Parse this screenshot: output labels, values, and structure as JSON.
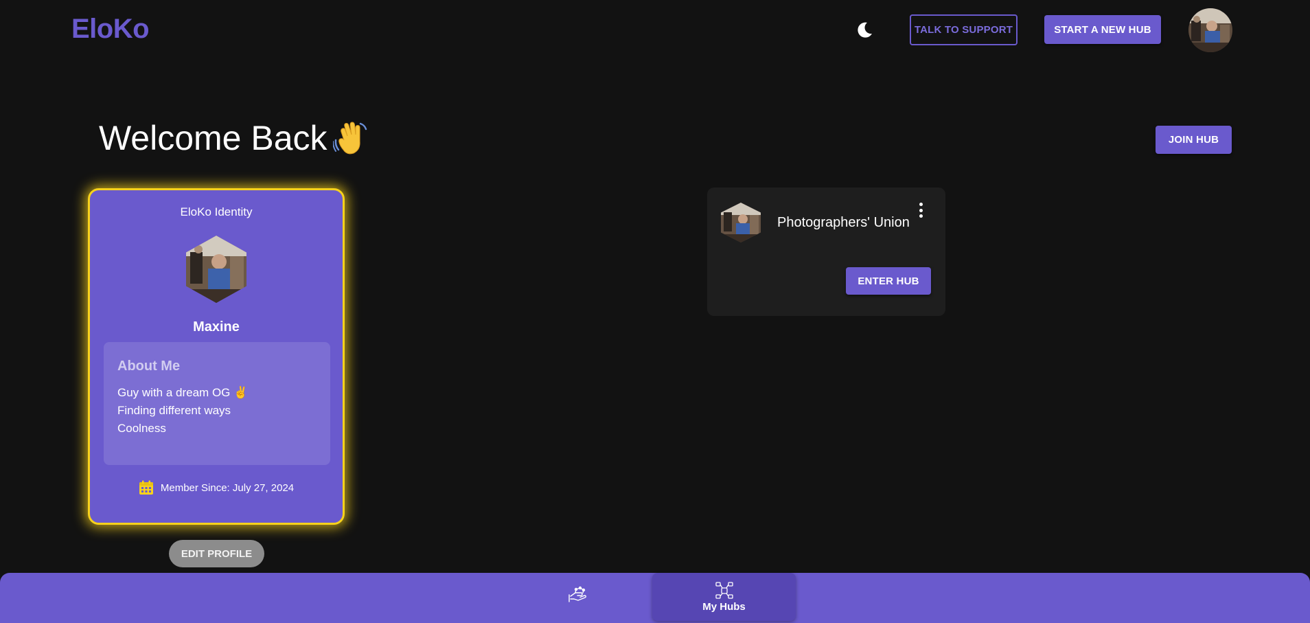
{
  "header": {
    "logo": "EloKo",
    "support_label": "TALK TO SUPPORT",
    "new_hub_label": "START A NEW HUB",
    "theme_icon": "moon-icon",
    "avatar_icon": "user-avatar"
  },
  "main": {
    "welcome": "Welcome Back",
    "welcome_emoji": "waving-hand-icon",
    "join_hub_label": "JOIN HUB"
  },
  "identity_card": {
    "title": "EloKo Identity",
    "name": "Maxine",
    "about_heading": "About Me",
    "about_lines": [
      "Guy with a dream OG ✌️",
      "Finding different ways",
      "Coolness"
    ],
    "member_since": "Member Since: July 27, 2024",
    "edit_label": "EDIT PROFILE",
    "border_color": "#f7d21c",
    "card_color": "#6a5acd"
  },
  "hubs": [
    {
      "name": "Photographers' Union",
      "enter_label": "ENTER HUB"
    }
  ],
  "bottom_nav": {
    "items": [
      {
        "icon": "hand-network-icon",
        "label": ""
      },
      {
        "icon": "hub-network-icon",
        "label": "My Hubs",
        "active": true
      }
    ]
  },
  "colors": {
    "accent": "#6a5acd",
    "background": "#121212",
    "highlight": "#f7d21c"
  }
}
